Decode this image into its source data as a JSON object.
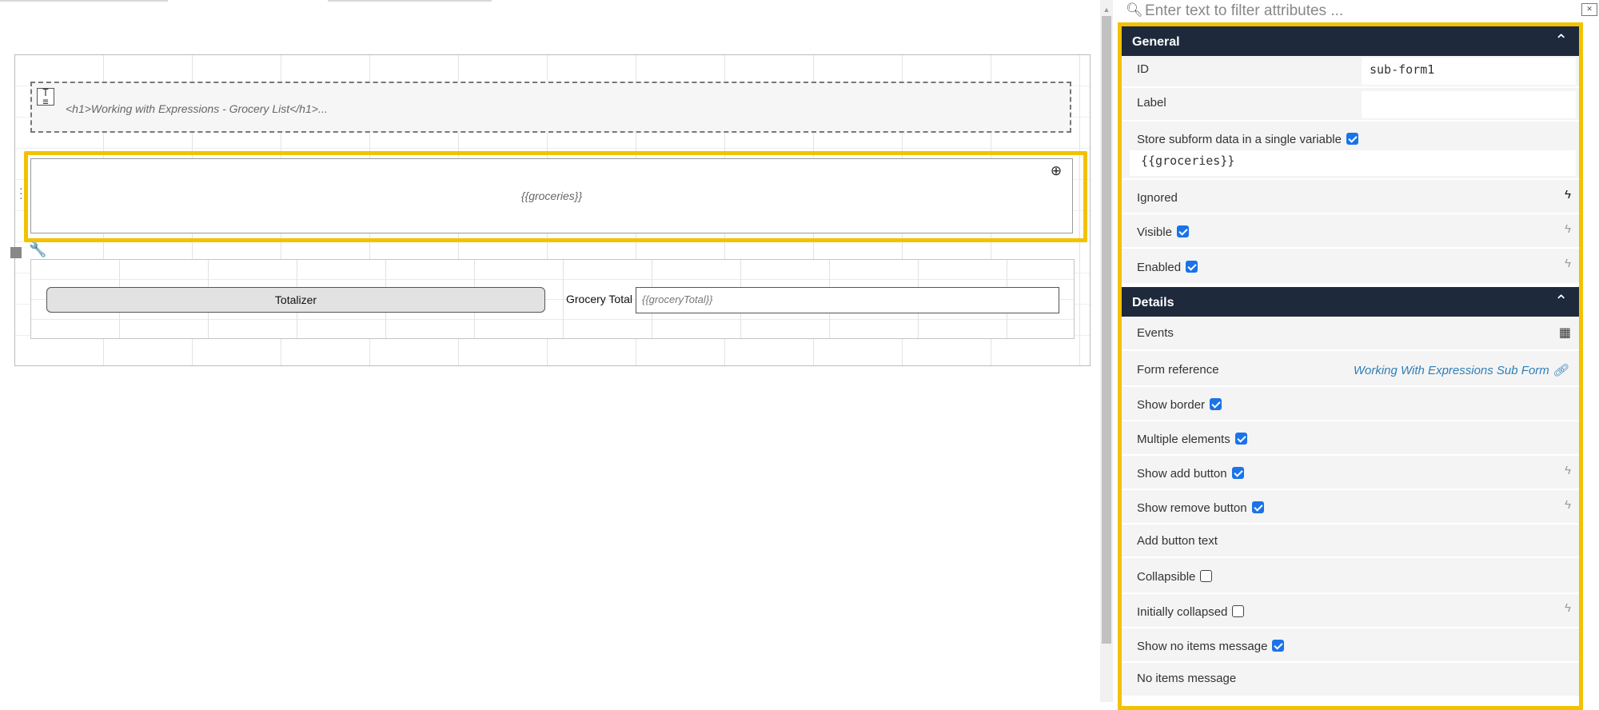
{
  "canvas": {
    "html_block_text": "<h1>Working with Expressions - Grocery List</h1>...",
    "subform_placeholder": "{{groceries}}",
    "totalizer_label": "Totalizer",
    "grocery_total_label": "Grocery Total",
    "grocery_total_placeholder": "{{groceryTotal}}"
  },
  "panel": {
    "filter_placeholder": "Enter text to filter attributes ...",
    "general": {
      "title": "General",
      "id_label": "ID",
      "id_value": "sub-form1",
      "label_label": "Label",
      "label_value": "",
      "store_label": "Store subform data in a single variable",
      "store_checked": true,
      "store_value": "{{groceries}}",
      "ignored_label": "Ignored",
      "visible_label": "Visible",
      "visible_checked": true,
      "enabled_label": "Enabled",
      "enabled_checked": true
    },
    "details": {
      "title": "Details",
      "events_label": "Events",
      "form_reference_label": "Form reference",
      "form_reference_value": "Working With Expressions Sub Form",
      "show_border_label": "Show border",
      "show_border_checked": true,
      "multiple_elements_label": "Multiple elements",
      "multiple_elements_checked": true,
      "show_add_button_label": "Show add button",
      "show_add_button_checked": true,
      "show_remove_button_label": "Show remove button",
      "show_remove_button_checked": true,
      "add_button_text_label": "Add button text",
      "collapsible_label": "Collapsible",
      "collapsible_checked": false,
      "initially_collapsed_label": "Initially collapsed",
      "initially_collapsed_checked": false,
      "show_no_items_label": "Show no items message",
      "show_no_items_checked": true,
      "no_items_message_label": "No items message"
    }
  },
  "colors": {
    "selection": "#f2c200",
    "section_header": "#1e2a3b",
    "checkbox": "#1a73e8",
    "link": "#2e7fb8"
  },
  "icons": [
    "search-icon",
    "clear-filter-icon",
    "chevron-up-icon",
    "bolt-icon",
    "grid-icon",
    "link-icon",
    "move-icon",
    "wrench-icon",
    "text-block-icon",
    "drag-handle-icon"
  ]
}
